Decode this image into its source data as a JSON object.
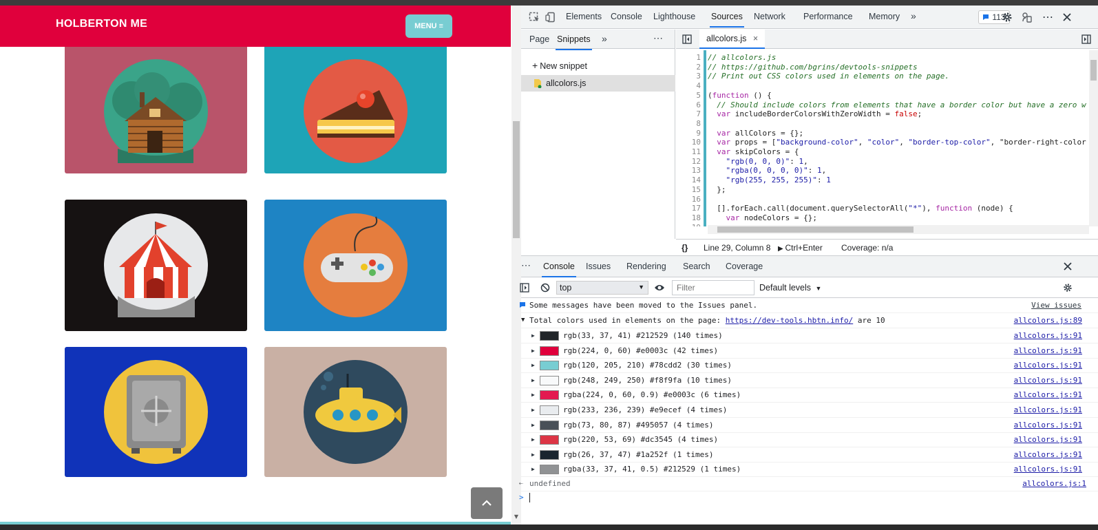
{
  "site": {
    "title": "HOLBERTON ME",
    "menu_label": "MENU ≡",
    "cards": [
      {
        "icon": "log-cabin-icon",
        "bg": "#b9546a"
      },
      {
        "icon": "cake-slice-icon",
        "bg": "#1ea4b7"
      },
      {
        "icon": "circus-tent-icon",
        "bg": "#161212"
      },
      {
        "icon": "gamepad-icon",
        "bg": "#1e84c4"
      },
      {
        "icon": "safe-icon",
        "bg": "#1033b9"
      },
      {
        "icon": "submarine-icon",
        "bg": "#c9b0a4"
      }
    ],
    "back_to_top_icon": "chevron-up-icon"
  },
  "devtools": {
    "panel_tabs": [
      "Elements",
      "Console",
      "Lighthouse",
      "Sources",
      "Network",
      "Performance",
      "Memory"
    ],
    "active_panel": "Sources",
    "issues_count": "113",
    "nav_tabs": [
      "Page",
      "Snippets"
    ],
    "active_nav_tab": "Snippets",
    "new_snippet_label": "New snippet",
    "snippet_file": "allcolors.js",
    "editor_tab": "allcolors.js",
    "code_lines": [
      "// allcolors.js",
      "// https://github.com/bgrins/devtools-snippets",
      "// Print out CSS colors used in elements on the page.",
      "",
      "(function () {",
      "  // Should include colors from elements that have a border color but have a zero w",
      "  var includeBorderColorsWithZeroWidth = false;",
      "",
      "  var allColors = {};",
      "  var props = [\"background-color\", \"color\", \"border-top-color\", \"border-right-color",
      "  var skipColors = {",
      "    \"rgb(0, 0, 0)\": 1,",
      "    \"rgba(0, 0, 0, 0)\": 1,",
      "    \"rgb(255, 255, 255)\": 1",
      "  };",
      "",
      "  [].forEach.call(document.querySelectorAll(\"*\"), function (node) {",
      "    var nodeColors = {};",
      ""
    ],
    "status": {
      "braces": "{}",
      "position": "Line 29, Column 8",
      "run": "Ctrl+Enter",
      "coverage": "Coverage: n/a"
    },
    "drawer_tabs": [
      "Console",
      "Issues",
      "Rendering",
      "Search",
      "Coverage"
    ],
    "active_drawer_tab": "Console",
    "context": "top",
    "filter_placeholder": "Filter",
    "levels": "Default levels",
    "console": {
      "moved_msg": "Some messages have been moved to the Issues panel.",
      "view_issues": "View issues",
      "total_prefix": "Total colors used in elements on the page: ",
      "total_link": "https://dev-tools.hbtn.info/",
      "total_suffix": " are 10",
      "total_src": "allcolors.js:89",
      "colors": [
        {
          "text": "rgb(33, 37, 41) #212529 (140 times)",
          "swatch": "#212529",
          "src": "allcolors.js:91"
        },
        {
          "text": "rgb(224, 0, 60) #e0003c (42 times)",
          "swatch": "#e0003c",
          "src": "allcolors.js:91"
        },
        {
          "text": "rgb(120, 205, 210) #78cdd2 (30 times)",
          "swatch": "#78cdd2",
          "src": "allcolors.js:91"
        },
        {
          "text": "rgb(248, 249, 250) #f8f9fa (10 times)",
          "swatch": "#f8f9fa",
          "src": "allcolors.js:91"
        },
        {
          "text": "rgba(224, 0, 60, 0.9) #e0003c (6 times)",
          "swatch": "#e31a50",
          "src": "allcolors.js:91"
        },
        {
          "text": "rgb(233, 236, 239) #e9ecef (4 times)",
          "swatch": "#e9ecef",
          "src": "allcolors.js:91"
        },
        {
          "text": "rgb(73, 80, 87) #495057 (4 times)",
          "swatch": "#495057",
          "src": "allcolors.js:91"
        },
        {
          "text": "rgb(220, 53, 69) #dc3545 (4 times)",
          "swatch": "#dc3545",
          "src": "allcolors.js:91"
        },
        {
          "text": "rgb(26, 37, 47) #1a252f (1 times)",
          "swatch": "#1a252f",
          "src": "allcolors.js:91"
        },
        {
          "text": "rgba(33, 37, 41, 0.5) #212529 (1 times)",
          "swatch": "#909294",
          "src": "allcolors.js:91"
        }
      ],
      "result": "undefined",
      "result_src": "allcolors.js:1",
      "prompt": ">"
    }
  }
}
